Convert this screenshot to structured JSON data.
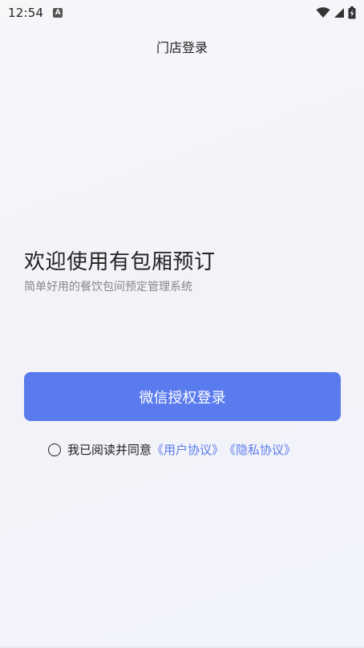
{
  "status_bar": {
    "time": "12:54",
    "notification_icon": "a-icon",
    "icons": [
      "wifi-icon",
      "signal-icon",
      "battery-charging-icon"
    ]
  },
  "header": {
    "title": "门店登录"
  },
  "welcome": {
    "title": "欢迎使用有包厢预订",
    "subtitle": "简单好用的餐饮包间预定管理系统"
  },
  "login": {
    "button_label": "微信授权登录"
  },
  "agreement": {
    "text": "我已阅读并同意",
    "user_agreement": "《用户协议》",
    "privacy_policy": "《隐私协议》"
  },
  "colors": {
    "accent": "#5a7bee",
    "text_primary": "#222222",
    "text_secondary": "#888888"
  }
}
